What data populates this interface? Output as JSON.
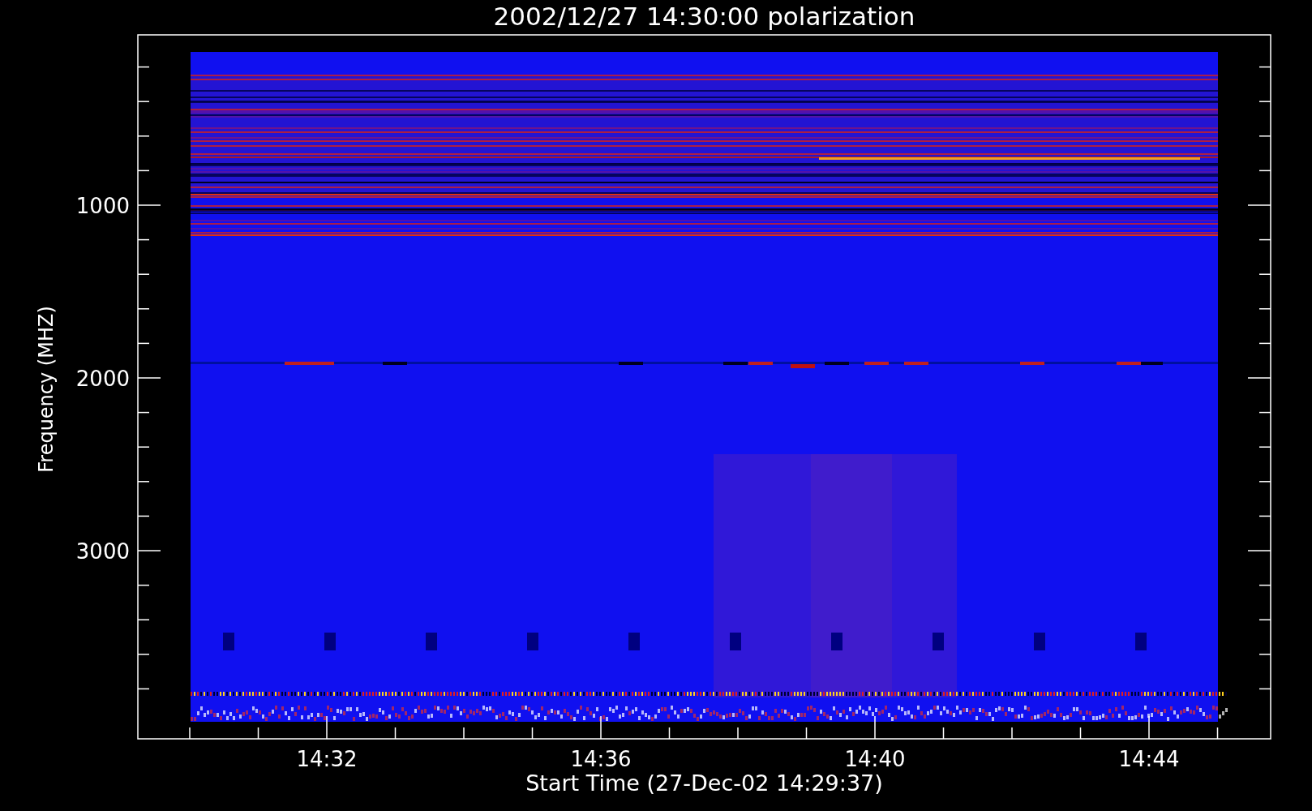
{
  "plot": {
    "title": "2002/12/27 14:30:00 polarization",
    "ylabel": "Frequency (MHZ)",
    "xlabel": "Start Time (27-Dec-02 14:29:37)",
    "yticks": [
      "1000",
      "2000",
      "3000"
    ],
    "xticks": [
      "14:32",
      "14:36",
      "14:40",
      "14:44"
    ]
  }
}
